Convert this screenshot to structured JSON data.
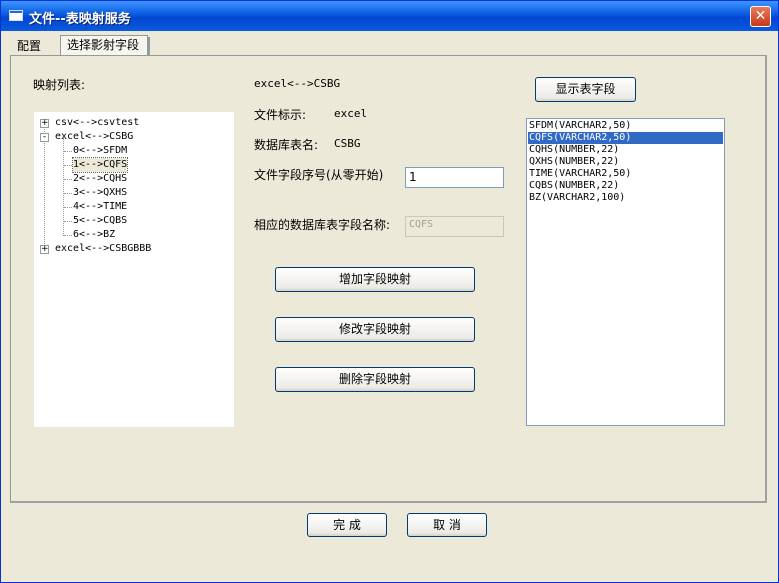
{
  "window": {
    "title": "文件--表映射服务",
    "close_glyph": "✕"
  },
  "tabs": [
    {
      "label": "配置"
    },
    {
      "label": "选择影射字段"
    }
  ],
  "mapping_list": {
    "label": "映射列表:",
    "nodes": [
      {
        "text": "csv<-->csvtest",
        "expander": "+"
      },
      {
        "text": "excel<-->CSBG",
        "expander": "-"
      },
      {
        "text": "0<-->SFDM"
      },
      {
        "text": "1<-->CQFS",
        "selected": true
      },
      {
        "text": "2<-->CQHS"
      },
      {
        "text": "3<-->QXHS"
      },
      {
        "text": "4<-->TIME"
      },
      {
        "text": "5<-->CQBS"
      },
      {
        "text": "6<-->BZ"
      },
      {
        "text": "excel<-->CSBGBBB",
        "expander": "+"
      }
    ]
  },
  "detail": {
    "mapping_title": "excel<-->CSBG",
    "file_id_label": "文件标示:",
    "file_id_value": "excel",
    "table_name_label": "数据库表名:",
    "table_name_value": "CSBG",
    "field_index_label": "文件字段序号(从零开始)",
    "field_index_value": "1",
    "db_field_label": "相应的数据库表字段名称:",
    "db_field_value": "CQFS"
  },
  "buttons": {
    "show_fields": "显示表字段",
    "add_mapping": "增加字段映射",
    "modify_mapping": "修改字段映射",
    "delete_mapping": "删除字段映射",
    "finish": "完 成",
    "cancel": "取 消"
  },
  "table_fields": [
    {
      "text": "SFDM(VARCHAR2,50)"
    },
    {
      "text": "CQFS(VARCHAR2,50)",
      "selected": true
    },
    {
      "text": "CQHS(NUMBER,22)"
    },
    {
      "text": "QXHS(NUMBER,22)"
    },
    {
      "text": "TIME(VARCHAR2,50)"
    },
    {
      "text": "CQBS(NUMBER,22)"
    },
    {
      "text": "BZ(VARCHAR2,100)"
    }
  ],
  "colors": {
    "title_bar": "#0a5adf",
    "selection": "#316ac5",
    "face": "#ece9d8"
  }
}
